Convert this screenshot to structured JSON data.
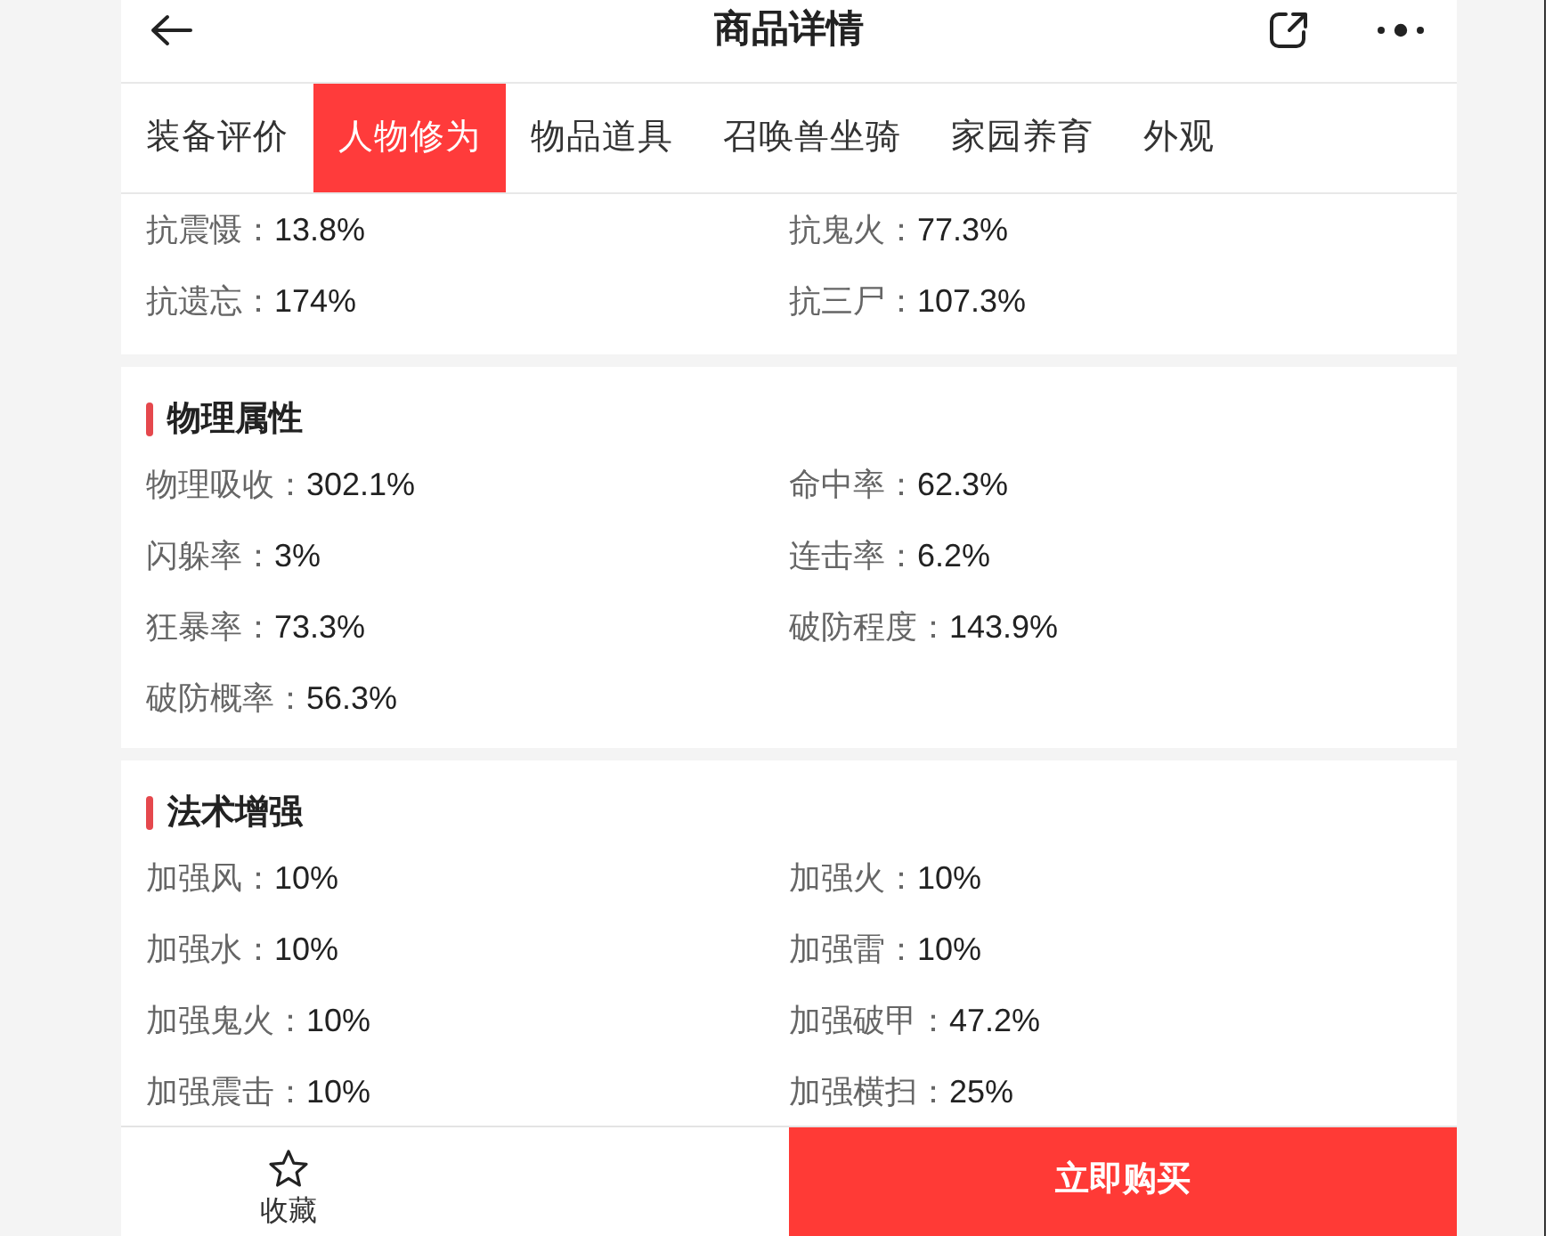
{
  "header": {
    "title": "商品详情"
  },
  "tabs": [
    {
      "label": "装备评价",
      "selected": false
    },
    {
      "label": "人物修为",
      "selected": true
    },
    {
      "label": "物品道具",
      "selected": false
    },
    {
      "label": "召唤兽坐骑",
      "selected": false
    },
    {
      "label": "家园养育",
      "selected": false
    },
    {
      "label": "外观",
      "selected": false
    }
  ],
  "sections": [
    {
      "stats": [
        {
          "label": "抗震慑：",
          "value": "13.8%"
        },
        {
          "label": "抗鬼火：",
          "value": "77.3%"
        },
        {
          "label": "抗遗忘：",
          "value": "174%"
        },
        {
          "label": "抗三尸：",
          "value": "107.3%"
        }
      ]
    },
    {
      "title": "物理属性",
      "stats": [
        {
          "label": "物理吸收：",
          "value": "302.1%"
        },
        {
          "label": "命中率：",
          "value": "62.3%"
        },
        {
          "label": "闪躲率：",
          "value": "3%"
        },
        {
          "label": "连击率：",
          "value": "6.2%"
        },
        {
          "label": "狂暴率：",
          "value": "73.3%"
        },
        {
          "label": "破防程度：",
          "value": "143.9%"
        },
        {
          "label": "破防概率：",
          "value": "56.3%"
        }
      ]
    },
    {
      "title": "法术增强",
      "stats": [
        {
          "label": "加强风：",
          "value": "10%"
        },
        {
          "label": "加强火：",
          "value": "10%"
        },
        {
          "label": "加强水：",
          "value": "10%"
        },
        {
          "label": "加强雷：",
          "value": "10%"
        },
        {
          "label": "加强鬼火：",
          "value": "10%"
        },
        {
          "label": "加强破甲：",
          "value": "47.2%"
        },
        {
          "label": "加强震击：",
          "value": "10%"
        },
        {
          "label": "加强横扫：",
          "value": "25%"
        }
      ]
    }
  ],
  "bottom_bar": {
    "favorite_label": "收藏",
    "buy_label": "立即购买"
  }
}
